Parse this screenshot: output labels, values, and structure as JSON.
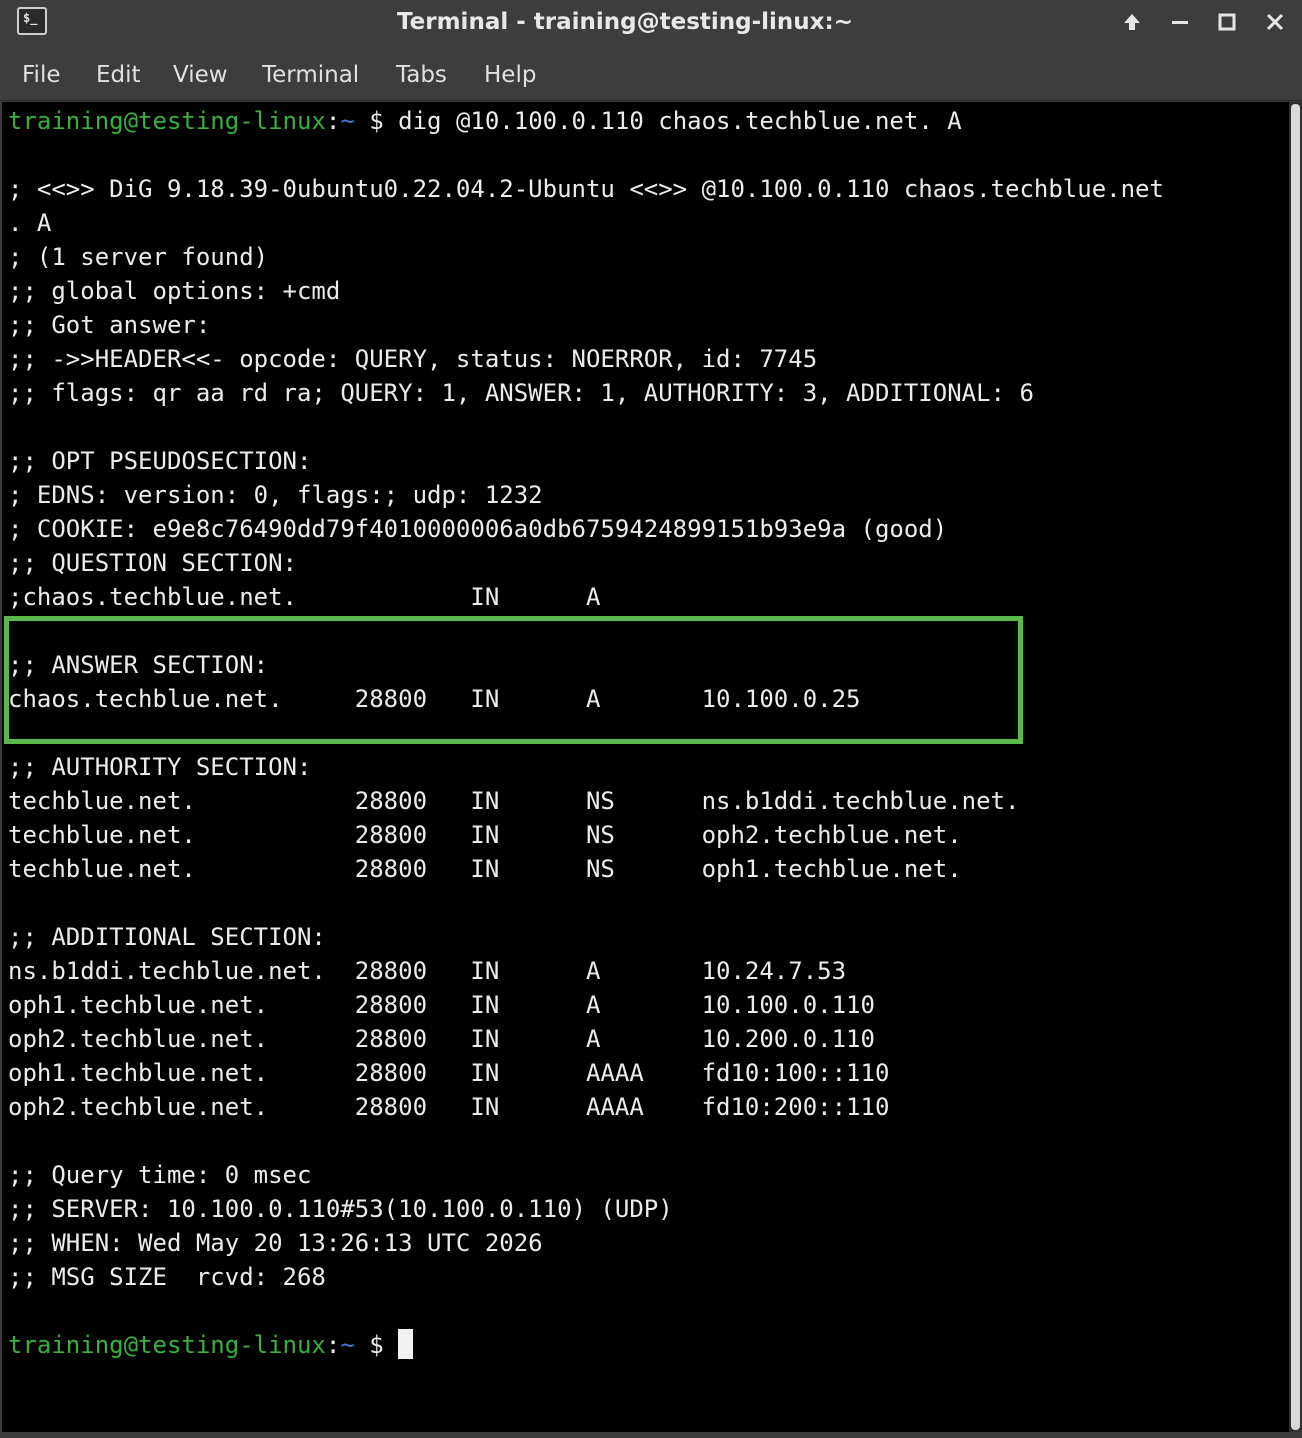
{
  "window": {
    "title": "Terminal - training@testing-linux:~",
    "app_icon_glyph": "$_",
    "controls": [
      "arrow-up-icon",
      "minimize-icon",
      "maximize-icon",
      "close-icon"
    ]
  },
  "menu": {
    "file": "File",
    "edit": "Edit",
    "view": "View",
    "terminal": "Terminal",
    "tabs": "Tabs",
    "help": "Help"
  },
  "prompt": {
    "user_host": "training@testing-linux",
    "colon": ":",
    "path": "~",
    "symbol": " $ "
  },
  "command": "dig @10.100.0.110 chaos.techblue.net. A",
  "output": [
    "",
    "; <<>> DiG 9.18.39-0ubuntu0.22.04.2-Ubuntu <<>> @10.100.0.110 chaos.techblue.net",
    ". A",
    "; (1 server found)",
    ";; global options: +cmd",
    ";; Got answer:",
    ";; ->>HEADER<<- opcode: QUERY, status: NOERROR, id: 7745",
    ";; flags: qr aa rd ra; QUERY: 1, ANSWER: 1, AUTHORITY: 3, ADDITIONAL: 6",
    "",
    ";; OPT PSEUDOSECTION:",
    "; EDNS: version: 0, flags:; udp: 1232",
    "; COOKIE: e9e8c76490dd79f4010000006a0db6759424899151b93e9a (good)",
    ";; QUESTION SECTION:",
    ";chaos.techblue.net.            IN      A",
    "",
    ";; ANSWER SECTION:",
    "chaos.techblue.net.     28800   IN      A       10.100.0.25",
    "",
    ";; AUTHORITY SECTION:",
    "techblue.net.           28800   IN      NS      ns.b1ddi.techblue.net.",
    "techblue.net.           28800   IN      NS      oph2.techblue.net.",
    "techblue.net.           28800   IN      NS      oph1.techblue.net.",
    "",
    ";; ADDITIONAL SECTION:",
    "ns.b1ddi.techblue.net.  28800   IN      A       10.24.7.53",
    "oph1.techblue.net.      28800   IN      A       10.100.0.110",
    "oph2.techblue.net.      28800   IN      A       10.200.0.110",
    "oph1.techblue.net.      28800   IN      AAAA    fd10:100::110",
    "oph2.techblue.net.      28800   IN      AAAA    fd10:200::110",
    "",
    ";; Query time: 0 msec",
    ";; SERVER: 10.100.0.110#53(10.100.0.110) (UDP)",
    ";; WHEN: Wed May 20 13:26:13 UTC 2026",
    ";; MSG SIZE  rcvd: 268",
    ""
  ],
  "colors": {
    "prompt_user": "#37b13c",
    "prompt_path": "#3a78c9",
    "highlight": "#5bb84b",
    "terminal_bg": "#000000",
    "text": "#ececec"
  }
}
